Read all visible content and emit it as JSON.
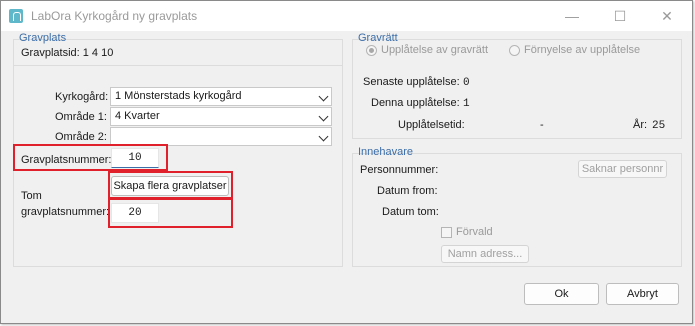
{
  "window": {
    "title": "LabOra Kyrkogård ny gravplats",
    "minimize_glyph": "—",
    "maximize_glyph": "☐",
    "close_glyph": "✕"
  },
  "gravplats": {
    "group_label": "Gravplats",
    "id_text": "Gravplatsid: 1 4  10",
    "kyrkogard_label": "Kyrkogård:",
    "kyrkogard_value": "1 Mönsterstads kyrkogård",
    "omrade1_label": "Område 1:",
    "omrade1_value": "4 Kvarter",
    "omrade2_label": "Område 2:",
    "omrade2_value": "",
    "nummer_label": "Gravplatsnummer:",
    "nummer_value": "10",
    "skapa_button": "Skapa flera gravplatser",
    "tom_label_line1": "Tom",
    "tom_label_line2": "gravplatsnummer:",
    "tom_value": "20"
  },
  "gravratt": {
    "group_label": "Gravrätt",
    "radio_upplatelse": "Upplåtelse av gravrätt",
    "radio_fornyelse": "Förnyelse av upplåtelse",
    "senaste_label": "Senaste upplåtelse:",
    "senaste_value": "0",
    "denna_label": "Denna upplåtelse:",
    "denna_value": "1",
    "upplatelsetid_label": "Upplåtelsetid:",
    "upplatelsetid_dash": "-",
    "ar_label": "År:",
    "ar_value": "25"
  },
  "innehavare": {
    "group_label": "Innehavare",
    "personnummer_label": "Personnummer:",
    "saknar_button": "Saknar personnr",
    "datum_from_label": "Datum from:",
    "datum_tom_label": "Datum tom:",
    "forvald_label": "Förvald",
    "namn_button": "Namn  adress..."
  },
  "footer": {
    "ok_button": "Ok",
    "cancel_button": "Avbryt"
  },
  "colors": {
    "highlight_box": "#e0202a",
    "group_label": "#3c6ea8"
  }
}
